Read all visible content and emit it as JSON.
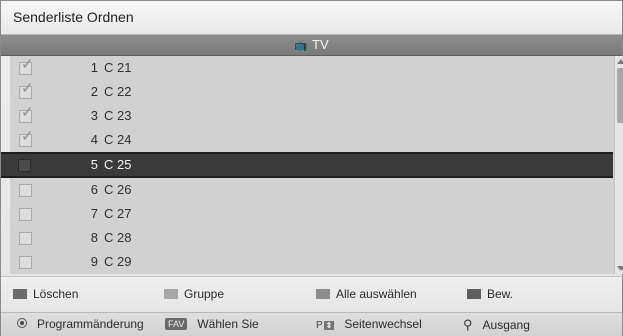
{
  "title": "Senderliste Ordnen",
  "header": {
    "icon": "tv-icon",
    "label": "TV"
  },
  "channels": [
    {
      "num": "1",
      "name": "C 21",
      "checked": true
    },
    {
      "num": "2",
      "name": "C 22",
      "checked": true
    },
    {
      "num": "3",
      "name": "C 23",
      "checked": true
    },
    {
      "num": "4",
      "name": "C 24",
      "checked": true
    },
    {
      "num": "5",
      "name": "C 25",
      "checked": false,
      "selected": true
    },
    {
      "num": "6",
      "name": "C 26",
      "checked": false
    },
    {
      "num": "7",
      "name": "C 27",
      "checked": false
    },
    {
      "num": "8",
      "name": "C 28",
      "checked": false
    },
    {
      "num": "9",
      "name": "C 29",
      "checked": false
    }
  ],
  "color_buttons": [
    {
      "label": "Löschen",
      "color": "#6b6b6b"
    },
    {
      "label": "Gruppe",
      "color": "#a6a6a6"
    },
    {
      "label": "Alle auswählen",
      "color": "#8c8c8c"
    },
    {
      "label": "Bew.",
      "color": "#5e5e5e"
    }
  ],
  "nav": {
    "program_change": "Programmänderung",
    "fav_key": "FAV",
    "select": "Wählen Sie",
    "page_key": "P",
    "page_change": "Seitenwechsel",
    "exit": "Ausgang"
  }
}
